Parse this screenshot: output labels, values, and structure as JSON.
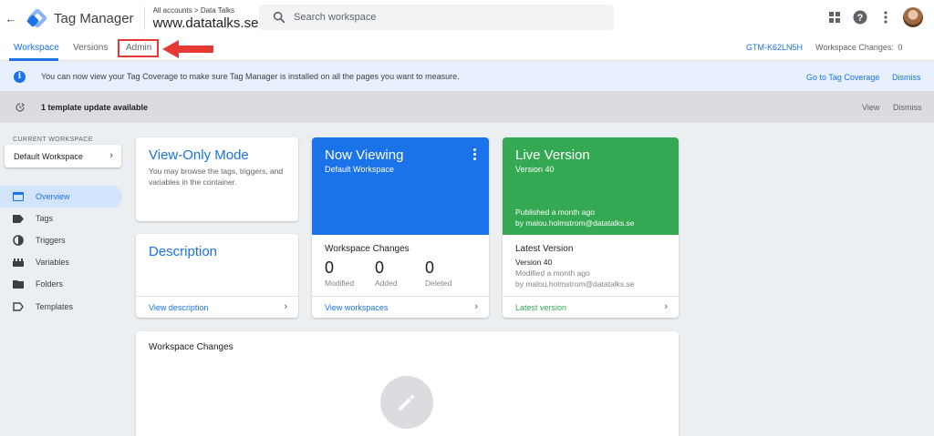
{
  "header": {
    "product_name": "Tag Manager",
    "breadcrumb": "All accounts > Data Talks",
    "container_name": "www.datatalks.se",
    "search_placeholder": "Search workspace"
  },
  "tabs": [
    {
      "label": "Workspace",
      "active": true
    },
    {
      "label": "Versions",
      "active": false
    },
    {
      "label": "Admin",
      "active": false
    }
  ],
  "container_id": "GTM-K62LN5H",
  "workspace_changes_label": "Workspace Changes:",
  "workspace_changes_count": "0",
  "banner": {
    "text": "You can now view your Tag Coverage to make sure Tag Manager is installed on all the pages you want to measure.",
    "link": "Go to Tag Coverage",
    "dismiss": "Dismiss"
  },
  "update_bar": {
    "text": "1 template update available",
    "view": "View",
    "dismiss": "Dismiss"
  },
  "sidebar": {
    "current_workspace_label": "CURRENT WORKSPACE",
    "current_workspace": "Default Workspace",
    "items": [
      {
        "label": "Overview",
        "icon": "overview-icon",
        "active": true
      },
      {
        "label": "Tags",
        "icon": "tag-icon",
        "active": false
      },
      {
        "label": "Triggers",
        "icon": "trigger-icon",
        "active": false
      },
      {
        "label": "Variables",
        "icon": "variables-icon",
        "active": false
      },
      {
        "label": "Folders",
        "icon": "folder-icon",
        "active": false
      },
      {
        "label": "Templates",
        "icon": "templates-icon",
        "active": false
      }
    ]
  },
  "cards": {
    "view_only": {
      "title": "View-Only Mode",
      "text": "You may browse the tags, triggers, and variables in the container."
    },
    "description": {
      "title": "Description",
      "footer": "View description"
    },
    "now_viewing": {
      "title": "Now Viewing",
      "subtitle": "Default Workspace",
      "section_title": "Workspace Changes",
      "counts": [
        {
          "value": "0",
          "label": "Modified"
        },
        {
          "value": "0",
          "label": "Added"
        },
        {
          "value": "0",
          "label": "Deleted"
        }
      ],
      "footer": "View workspaces"
    },
    "live_version": {
      "title": "Live Version",
      "subtitle": "Version 40",
      "published": "Published a month ago",
      "published_by": "by malou.holmstrom@datatalks.se",
      "section_title": "Latest Version",
      "latest_version": "Version 40",
      "modified": "Modified a month ago",
      "modified_by": "by malou.holmstrom@datatalks.se",
      "footer": "Latest version"
    },
    "workspace_changes": {
      "title": "Workspace Changes"
    }
  },
  "colors": {
    "accent": "#1a73e8",
    "now_viewing_bg": "#1a73e8",
    "live_version_bg": "#34a853",
    "highlight": "#e53935"
  }
}
